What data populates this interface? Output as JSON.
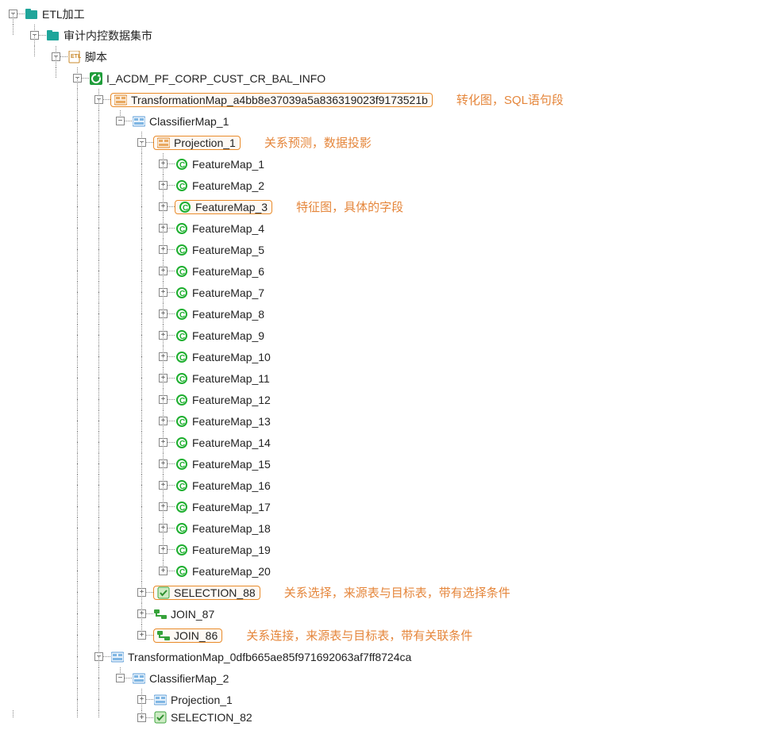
{
  "tree": {
    "root": "ETL加工",
    "n1": "审计内控数据集市",
    "n2": "脚本",
    "n3": "I_ACDM_PF_CORP_CUST_CR_BAL_INFO",
    "tmap1": "TransformationMap_a4bb8e37039a5a836319023f9173521b",
    "cmap1": "ClassifierMap_1",
    "proj1": "Projection_1",
    "features": [
      "FeatureMap_1",
      "FeatureMap_2",
      "FeatureMap_3",
      "FeatureMap_4",
      "FeatureMap_5",
      "FeatureMap_6",
      "FeatureMap_7",
      "FeatureMap_8",
      "FeatureMap_9",
      "FeatureMap_10",
      "FeatureMap_11",
      "FeatureMap_12",
      "FeatureMap_13",
      "FeatureMap_14",
      "FeatureMap_15",
      "FeatureMap_16",
      "FeatureMap_17",
      "FeatureMap_18",
      "FeatureMap_19",
      "FeatureMap_20"
    ],
    "sel88": "SELECTION_88",
    "join87": "JOIN_87",
    "join86": "JOIN_86",
    "tmap2": "TransformationMap_0dfb665ae85f971692063af7ff8724ca",
    "cmap2": "ClassifierMap_2",
    "proj2": "Projection_1",
    "sel82": "SELECTION_82"
  },
  "annotations": {
    "tmap": "转化图，SQL语句段",
    "proj": "关系预测，数据投影",
    "feat": "特征图，具体的字段",
    "sel": "关系选择，来源表与目标表，带有选择条件",
    "join": "关系连接，来源表与目标表，带有关联条件"
  }
}
